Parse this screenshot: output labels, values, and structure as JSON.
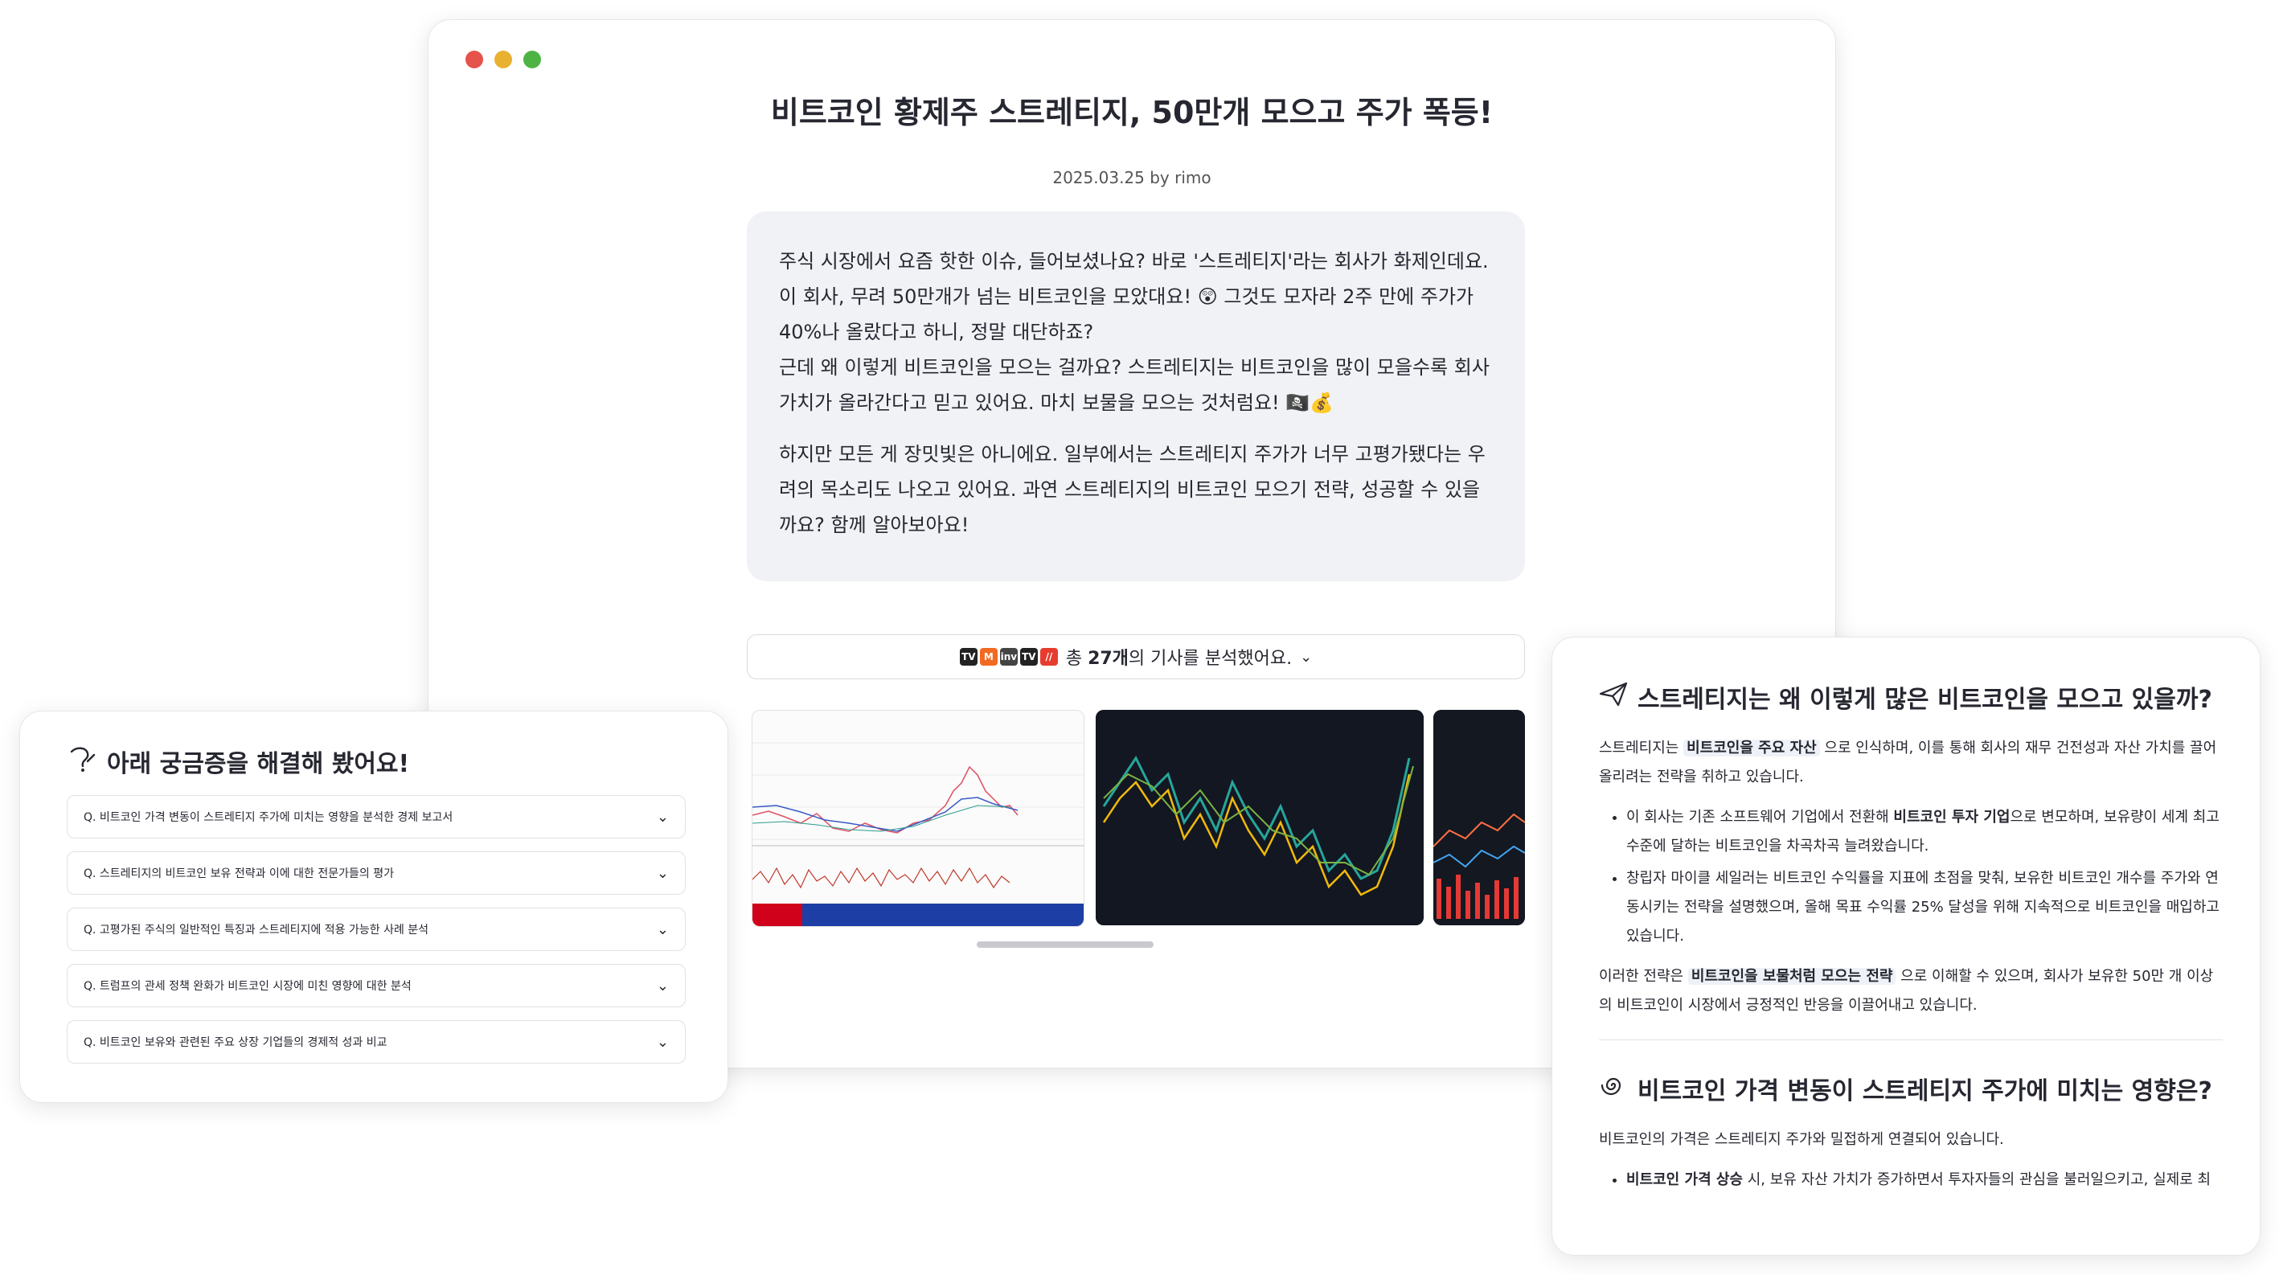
{
  "article": {
    "title": "비트코인 황제주 스트레티지, 50만개 모으고 주가 폭등!",
    "meta": "2025.03.25 by rimo",
    "summary": [
      "주식 시장에서 요즘 핫한 이슈, 들어보셨나요? 바로 '스트레티지'라는 회사가 화제인데요. 이 회사, 무려 50만개가 넘는 비트코인을 모았대요! 😲 그것도 모자라 2주 만에 주가가 40%나 올랐다고 하니, 정말 대단하죠?",
      "근데 왜 이렇게 비트코인을 모으는 걸까요? 스트레티지는 비트코인을 많이 모을수록 회사 가치가 올라간다고 믿고 있어요. 마치 보물을 모으는 것처럼요! 🏴‍☠️💰",
      "하지만 모든 게 장밋빛은 아니에요. 일부에서는 스트레티지 주가가 너무 고평가됐다는 우려의 목소리도 나오고 있어요. 과연 스트레티지의 비트코인 모으기 전략, 성공할 수 있을까요? 함께 알아보아요!"
    ],
    "sources": {
      "prefix": "총 ",
      "count": "27개",
      "suffix": "의 기사를 분석했어요.",
      "icons": [
        "news-icon-1",
        "news-icon-2",
        "news-icon-3",
        "news-icon-4",
        "news-icon-5"
      ]
    }
  },
  "window_dots": [
    "#e5534b",
    "#e8b130",
    "#4db444"
  ],
  "questions": {
    "title": "아래 궁금증을 해결해 봤어요!",
    "items": [
      "Q. 비트코인 가격 변동이 스트레티지 주가에 미치는 영향을 분석한 경제 보고서",
      "Q. 스트레티지의 비트코인 보유 전략과 이에 대한 전문가들의 평가",
      "Q. 고평가된 주식의 일반적인 특징과 스트레티지에 적용 가능한 사례 분석",
      "Q. 트럼프의 관세 정책 완화가 비트코인 시장에 미친 영향에 대한 분석",
      "Q. 비트코인 보유와 관련된 주요 상장 기업들의 경제적 성과 비교"
    ]
  },
  "explain": {
    "section1": {
      "heading": "스트레티지는 왜 이렇게 많은 비트코인을 모으고 있을까?",
      "p1_pre": "스트레티지는 ",
      "p1_hl": "비트코인을 주요 자산",
      "p1_post": " 으로 인식하며, 이를 통해 회사의 재무 건전성과 자산 가치를 끌어올리려는 전략을 취하고 있습니다.",
      "b1_pre": "이 회사는 기존 소프트웨어 기업에서 전환해 ",
      "b1_bold": "비트코인 투자 기업",
      "b1_post": "으로 변모하며, 보유량이 세계 최고 수준에 달하는 비트코인을 차곡차곡 늘려왔습니다.",
      "b2": "창립자 마이클 세일러는 비트코인 수익률을 지표에 초점을 맞춰, 보유한 비트코인 개수를 주가와 연동시키는 전략을 설명했으며, 올해 목표 수익률 25% 달성을 위해 지속적으로 비트코인을 매입하고 있습니다.",
      "p2_pre": "이러한 전략은 ",
      "p2_hl": "비트코인을 보물처럼 모으는 전략",
      "p2_post": " 으로 이해할 수 있으며, 회사가 보유한 50만 개 이상의 비트코인이 시장에서 긍정적인 반응을 이끌어내고 있습니다."
    },
    "section2": {
      "heading": "비트코인 가격 변동이 스트레티지 주가에 미치는 영향은?",
      "p1": "비트코인의 가격은 스트레티지 주가와 밀접하게 연결되어 있습니다.",
      "b1_bold": "비트코인 가격 상승",
      "b1_post": " 시, 보유 자산 가치가 증가하면서 투자자들의 관심을 불러일으키고, 실제로 최"
    }
  }
}
